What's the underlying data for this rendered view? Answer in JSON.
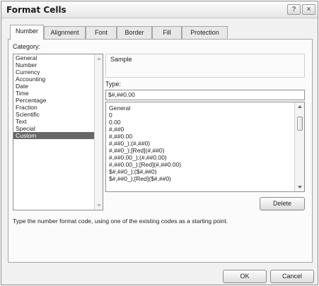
{
  "dialog": {
    "title": "Format Cells",
    "help_symbol": "?",
    "close_symbol": "×"
  },
  "tabs": [
    {
      "label": "Number"
    },
    {
      "label": "Alignment"
    },
    {
      "label": "Font"
    },
    {
      "label": "Border"
    },
    {
      "label": "Fill"
    },
    {
      "label": "Protection"
    }
  ],
  "category": {
    "label": "Category:",
    "items": [
      "General",
      "Number",
      "Currency",
      "Accounting",
      "Date",
      "Time",
      "Percentage",
      "Fraction",
      "Scientific",
      "Text",
      "Special",
      "Custom"
    ],
    "selected": "Custom"
  },
  "sample": {
    "label": "Sample",
    "value": ""
  },
  "type": {
    "label": "Type:",
    "value": "$#,##0.00",
    "items": [
      "General",
      "0",
      "0.00",
      "#,##0",
      "#,##0.00",
      "#,##0_);(#,##0)",
      "#,##0_);[Red](#,##0)",
      "#,##0.00_);(#,##0.00)",
      "#,##0.00_);[Red](#,##0.00)",
      "$#,##0_);($#,##0)",
      "$#,##0_);[Red]($#,##0)"
    ]
  },
  "buttons": {
    "delete": "Delete",
    "ok": "OK",
    "cancel": "Cancel"
  },
  "description": "Type the number format code, using one of the existing codes as a starting point."
}
